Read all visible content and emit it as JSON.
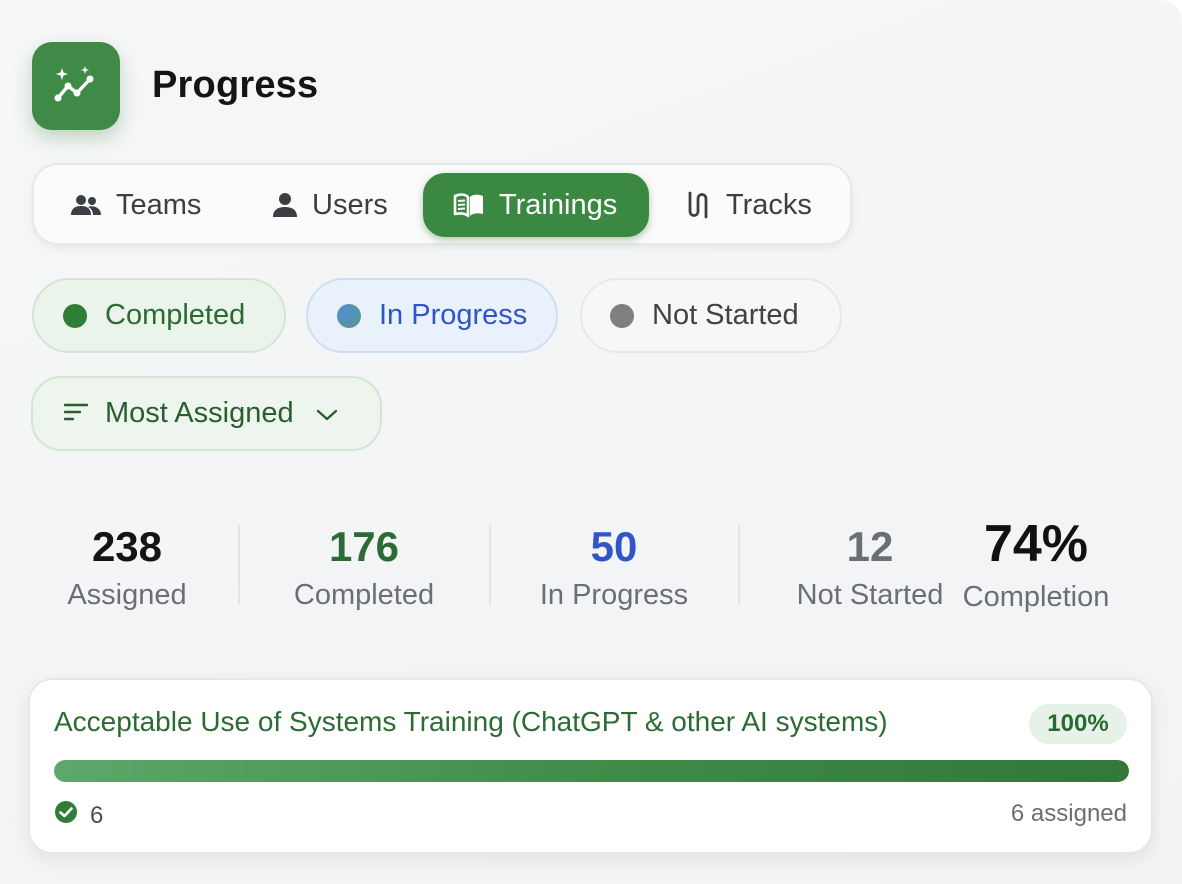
{
  "header": {
    "title": "Progress",
    "icon": "sparkle-trend-icon"
  },
  "tabs": [
    {
      "label": "Teams",
      "icon": "teams-icon",
      "active": false
    },
    {
      "label": "Users",
      "icon": "user-icon",
      "active": false
    },
    {
      "label": "Trainings",
      "icon": "book-icon",
      "active": true
    },
    {
      "label": "Tracks",
      "icon": "tracks-icon",
      "active": false
    }
  ],
  "filters": [
    {
      "label": "Completed",
      "color": "#2f7d37"
    },
    {
      "label": "In Progress",
      "color": "#2f55c7"
    },
    {
      "label": "Not Started",
      "color": "#7e807e"
    }
  ],
  "sort": {
    "label": "Most Assigned",
    "icon": "sort-lines-icon"
  },
  "stats": {
    "assigned": {
      "value": "238",
      "label": "Assigned"
    },
    "completed": {
      "value": "176",
      "label": "Completed"
    },
    "in_progress": {
      "value": "50",
      "label": "In Progress"
    },
    "not_started": {
      "value": "12",
      "label": "Not Started"
    },
    "completion": {
      "value": "74%",
      "label": "Completion"
    }
  },
  "trainings": [
    {
      "title": "Acceptable Use of Systems Training (ChatGPT & other AI systems)",
      "percent_label": "100%",
      "progress": 1.0,
      "completed_count": "6",
      "assigned_label": "6 assigned"
    }
  ],
  "colors": {
    "accent": "#3b8842",
    "completed": "#2c6b33",
    "in_progress": "#2f55c7",
    "not_started": "#6b6f75"
  }
}
